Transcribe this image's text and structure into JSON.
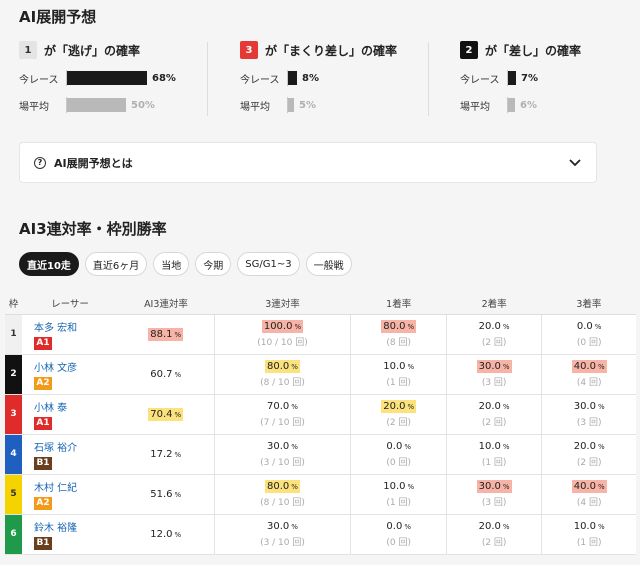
{
  "section1_title": "AI展開予想",
  "probabilities": [
    {
      "badge": "1",
      "badge_style": "gray",
      "text": "が「逃げ」の確率",
      "current_label": "今レース",
      "current_value": "68%",
      "current_fraction": 0.68,
      "average_label": "場平均",
      "average_value": "50%",
      "average_fraction": 0.5
    },
    {
      "badge": "3",
      "badge_style": "red",
      "text": "が「まくり差し」の確率",
      "current_label": "今レース",
      "current_value": "8%",
      "current_fraction": 0.08,
      "average_label": "場平均",
      "average_value": "5%",
      "average_fraction": 0.05
    },
    {
      "badge": "2",
      "badge_style": "black",
      "text": "が「差し」の確率",
      "current_label": "今レース",
      "current_value": "7%",
      "current_fraction": 0.07,
      "average_label": "場平均",
      "average_value": "6%",
      "average_fraction": 0.06
    }
  ],
  "accordion": {
    "label": "AI展開予想とは",
    "icon": "question-circle-icon",
    "chevron": "chevron-down-icon"
  },
  "section2_title": "AI3連対率・枠別勝率",
  "filters": [
    {
      "label": "直近10走",
      "active": true
    },
    {
      "label": "直近6ヶ月",
      "active": false
    },
    {
      "label": "当地",
      "active": false
    },
    {
      "label": "今期",
      "active": false
    },
    {
      "label": "SG/G1~3",
      "active": false
    },
    {
      "label": "一般戦",
      "active": false
    }
  ],
  "table": {
    "headers": [
      "枠",
      "レーサー",
      "AI3連対率",
      "3連対率",
      "1着率",
      "2着率",
      "3着率"
    ],
    "frame_colors": [
      "#f0f0f0",
      "#111111",
      "#e02b2b",
      "#1f5fbf",
      "#f5d300",
      "#1e9a4a"
    ],
    "frame_text_colors": [
      "#333333",
      "#ffffff",
      "#ffffff",
      "#ffffff",
      "#333333",
      "#ffffff"
    ],
    "rows": [
      {
        "frame": "1",
        "name": "本多 宏和",
        "class": "A1",
        "ai": "88.1",
        "ai_hl": "r",
        "c": [
          {
            "v": "100.0",
            "s": "(10 / 10 回)",
            "hl": "r"
          },
          {
            "v": "80.0",
            "s": "(8 回)",
            "hl": "r"
          },
          {
            "v": "20.0",
            "s": "(2 回)",
            "hl": ""
          },
          {
            "v": "0.0",
            "s": "(0 回)",
            "hl": ""
          }
        ]
      },
      {
        "frame": "2",
        "name": "小林 文彦",
        "class": "A2",
        "ai": "60.7",
        "ai_hl": "",
        "c": [
          {
            "v": "80.0",
            "s": "(8 / 10 回)",
            "hl": "y"
          },
          {
            "v": "10.0",
            "s": "(1 回)",
            "hl": ""
          },
          {
            "v": "30.0",
            "s": "(3 回)",
            "hl": "r"
          },
          {
            "v": "40.0",
            "s": "(4 回)",
            "hl": "r"
          }
        ]
      },
      {
        "frame": "3",
        "name": "小林 泰",
        "class": "A1",
        "ai": "70.4",
        "ai_hl": "y",
        "c": [
          {
            "v": "70.0",
            "s": "(7 / 10 回)",
            "hl": ""
          },
          {
            "v": "20.0",
            "s": "(2 回)",
            "hl": "y"
          },
          {
            "v": "20.0",
            "s": "(2 回)",
            "hl": ""
          },
          {
            "v": "30.0",
            "s": "(3 回)",
            "hl": ""
          }
        ]
      },
      {
        "frame": "4",
        "name": "石塚 裕介",
        "class": "B1",
        "ai": "17.2",
        "ai_hl": "",
        "c": [
          {
            "v": "30.0",
            "s": "(3 / 10 回)",
            "hl": ""
          },
          {
            "v": "0.0",
            "s": "(0 回)",
            "hl": ""
          },
          {
            "v": "10.0",
            "s": "(1 回)",
            "hl": ""
          },
          {
            "v": "20.0",
            "s": "(2 回)",
            "hl": ""
          }
        ]
      },
      {
        "frame": "5",
        "name": "木村 仁紀",
        "class": "A2",
        "ai": "51.6",
        "ai_hl": "",
        "c": [
          {
            "v": "80.0",
            "s": "(8 / 10 回)",
            "hl": "y"
          },
          {
            "v": "10.0",
            "s": "(1 回)",
            "hl": ""
          },
          {
            "v": "30.0",
            "s": "(3 回)",
            "hl": "r"
          },
          {
            "v": "40.0",
            "s": "(4 回)",
            "hl": "r"
          }
        ]
      },
      {
        "frame": "6",
        "name": "鈴木 裕隆",
        "class": "B1",
        "ai": "12.0",
        "ai_hl": "",
        "c": [
          {
            "v": "30.0",
            "s": "(3 / 10 回)",
            "hl": ""
          },
          {
            "v": "0.0",
            "s": "(0 回)",
            "hl": ""
          },
          {
            "v": "20.0",
            "s": "(2 回)",
            "hl": ""
          },
          {
            "v": "10.0",
            "s": "(1 回)",
            "hl": ""
          }
        ]
      }
    ],
    "unit": "%"
  }
}
